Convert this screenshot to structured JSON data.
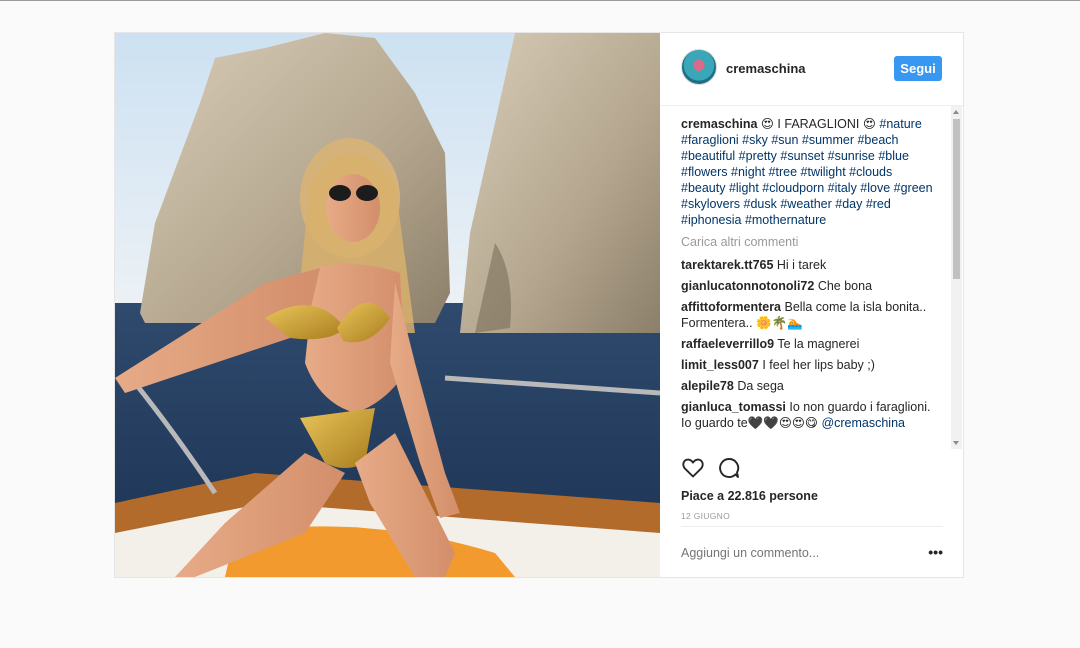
{
  "post": {
    "username": "cremaschina",
    "follow_label": "Segui",
    "caption": {
      "username": "cremaschina",
      "text_prefix": "😍 I FARAGLIONI 😍",
      "hashtags": "#nature #faraglioni #sky #sun #summer #beach #beautiful #pretty #sunset #sunrise #blue #flowers #night #tree #twilight #clouds #beauty #light #cloudporn #italy #love #green #skylovers #dusk #weather #day #red #iphonesia #mothernature"
    },
    "load_more_label": "Carica altri commenti",
    "comments": [
      {
        "user": "tarektarek.tt765",
        "text": "Hi i tarek"
      },
      {
        "user": "gianlucatonnotonoli72",
        "text": "Che bona"
      },
      {
        "user": "affittoformentera",
        "text": "Bella come la isla bonita.. Formentera.. 🌼🌴🏊"
      },
      {
        "user": "raffaeleverrillo9",
        "text": "Te la magnerei"
      },
      {
        "user": "limit_less007",
        "text": "I feel her lips baby ;)"
      },
      {
        "user": "alepile78",
        "text": "Da sega"
      },
      {
        "user": "gianluca_tomassi",
        "text": "Io non guardo i faraglioni. Io guardo te🖤🖤😍😍😋",
        "mention": "@cremaschina"
      }
    ],
    "likes_text": "Piace a 22.816 persone",
    "date": "12 GIUGNO",
    "add_comment_placeholder": "Aggiungi un commento...",
    "more_options": "•••",
    "icons": {
      "like": "heart-icon",
      "comment": "comment-icon",
      "more": "more-options-icon"
    },
    "colors": {
      "follow_button": "#3897f0",
      "hashtag": "#003569",
      "muted": "#999999"
    }
  }
}
